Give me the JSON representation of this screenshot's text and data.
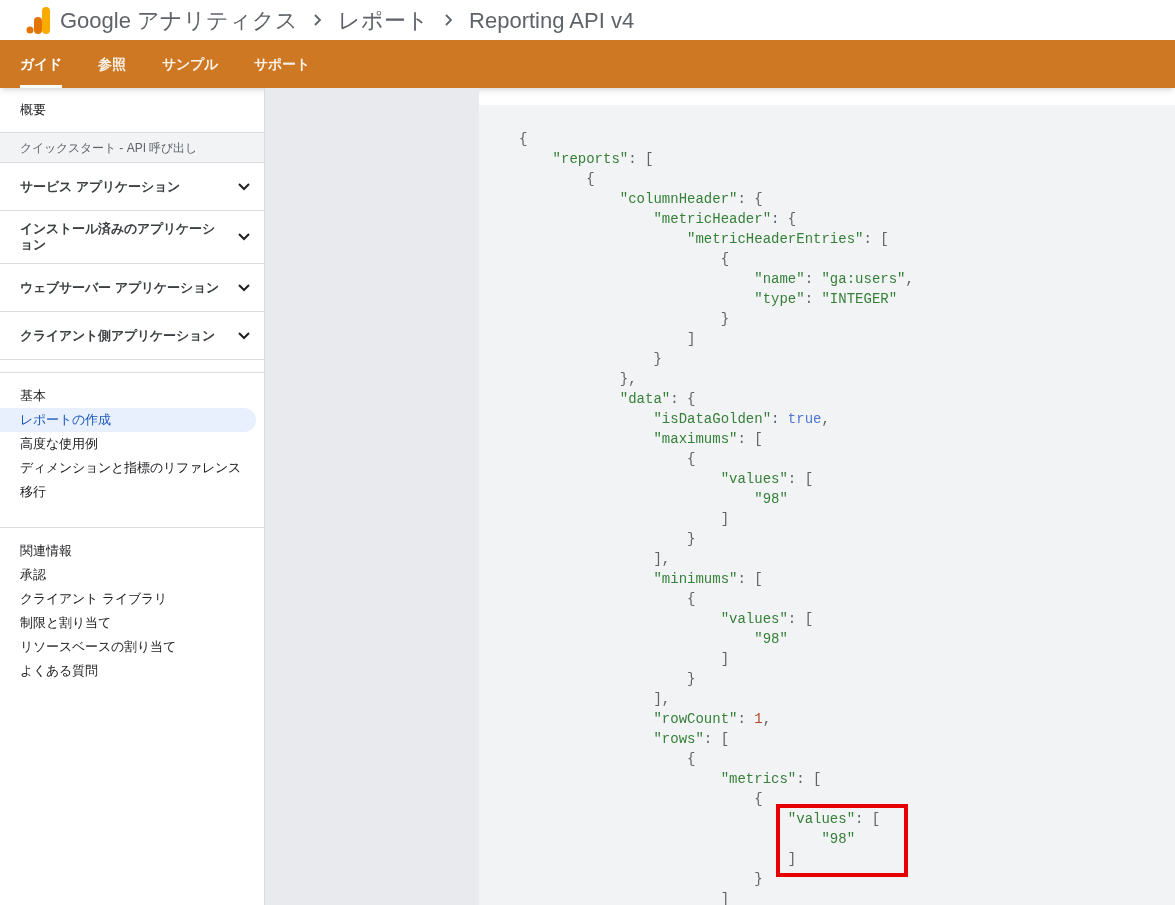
{
  "header": {
    "breadcrumbs": [
      "Google アナリティクス",
      "レポート",
      "Reporting API v4"
    ]
  },
  "tabs": [
    {
      "label": "ガイド",
      "selected": true
    },
    {
      "label": "参照",
      "selected": false
    },
    {
      "label": "サンプル",
      "selected": false
    },
    {
      "label": "サポート",
      "selected": false
    }
  ],
  "sidebar": {
    "top": [
      {
        "kind": "link",
        "label": "概要"
      },
      {
        "kind": "section_header",
        "label": "クイックスタート - API 呼び出し"
      },
      {
        "kind": "expandable",
        "label": "サービス アプリケーション",
        "expanded": false
      },
      {
        "kind": "expandable",
        "label": "インストール済みのアプリケーション",
        "expanded": false
      },
      {
        "kind": "expandable",
        "label": "ウェブサーバー アプリケーション",
        "expanded": false
      },
      {
        "kind": "expandable",
        "label": "クライアント側アプリケーション",
        "expanded": false
      }
    ],
    "groups": [
      [
        {
          "label": "基本",
          "selected": false
        },
        {
          "label": "レポートの作成",
          "selected": true
        },
        {
          "label": "高度な使用例",
          "selected": false
        },
        {
          "label": "ディメンションと指標のリファレンス",
          "selected": false
        },
        {
          "label": "移行",
          "selected": false
        }
      ],
      [
        {
          "label": "関連情報",
          "selected": false
        },
        {
          "label": "承認",
          "selected": false
        },
        {
          "label": "クライアント ライブラリ",
          "selected": false
        },
        {
          "label": "制限と割り当て",
          "selected": false
        },
        {
          "label": "リソースベースの割り当て",
          "selected": false
        },
        {
          "label": "よくある質問",
          "selected": false
        }
      ]
    ]
  },
  "code": {
    "lines": [
      [
        {
          "kind": "punct",
          "text": "{"
        }
      ],
      [
        {
          "kind": "string",
          "text": "    \"reports\""
        },
        {
          "kind": "punct",
          "text": ": ["
        }
      ],
      [
        {
          "kind": "punct",
          "text": "        {"
        }
      ],
      [
        {
          "kind": "string",
          "text": "            \"columnHeader\""
        },
        {
          "kind": "punct",
          "text": ": {"
        }
      ],
      [
        {
          "kind": "string",
          "text": "                \"metricHeader\""
        },
        {
          "kind": "punct",
          "text": ": {"
        }
      ],
      [
        {
          "kind": "string",
          "text": "                    \"metricHeaderEntries\""
        },
        {
          "kind": "punct",
          "text": ": ["
        }
      ],
      [
        {
          "kind": "punct",
          "text": "                        {"
        }
      ],
      [
        {
          "kind": "string",
          "text": "                            \"name\""
        },
        {
          "kind": "punct",
          "text": ": "
        },
        {
          "kind": "string",
          "text": "\"ga:users\""
        },
        {
          "kind": "punct",
          "text": ","
        }
      ],
      [
        {
          "kind": "string",
          "text": "                            \"type\""
        },
        {
          "kind": "punct",
          "text": ": "
        },
        {
          "kind": "string",
          "text": "\"INTEGER\""
        }
      ],
      [
        {
          "kind": "punct",
          "text": "                        }"
        }
      ],
      [
        {
          "kind": "punct",
          "text": "                    ]"
        }
      ],
      [
        {
          "kind": "punct",
          "text": "                }"
        }
      ],
      [
        {
          "kind": "punct",
          "text": "            },"
        }
      ],
      [
        {
          "kind": "string",
          "text": "            \"data\""
        },
        {
          "kind": "punct",
          "text": ": {"
        }
      ],
      [
        {
          "kind": "string",
          "text": "                \"isDataGolden\""
        },
        {
          "kind": "punct",
          "text": ": "
        },
        {
          "kind": "literal",
          "text": "true"
        },
        {
          "kind": "punct",
          "text": ","
        }
      ],
      [
        {
          "kind": "string",
          "text": "                \"maximums\""
        },
        {
          "kind": "punct",
          "text": ": ["
        }
      ],
      [
        {
          "kind": "punct",
          "text": "                    {"
        }
      ],
      [
        {
          "kind": "string",
          "text": "                        \"values\""
        },
        {
          "kind": "punct",
          "text": ": ["
        }
      ],
      [
        {
          "kind": "string",
          "text": "                            \"98\""
        }
      ],
      [
        {
          "kind": "punct",
          "text": "                        ]"
        }
      ],
      [
        {
          "kind": "punct",
          "text": "                    }"
        }
      ],
      [
        {
          "kind": "punct",
          "text": "                ],"
        }
      ],
      [
        {
          "kind": "string",
          "text": "                \"minimums\""
        },
        {
          "kind": "punct",
          "text": ": ["
        }
      ],
      [
        {
          "kind": "punct",
          "text": "                    {"
        }
      ],
      [
        {
          "kind": "string",
          "text": "                        \"values\""
        },
        {
          "kind": "punct",
          "text": ": ["
        }
      ],
      [
        {
          "kind": "string",
          "text": "                            \"98\""
        }
      ],
      [
        {
          "kind": "punct",
          "text": "                        ]"
        }
      ],
      [
        {
          "kind": "punct",
          "text": "                    }"
        }
      ],
      [
        {
          "kind": "punct",
          "text": "                ],"
        }
      ],
      [
        {
          "kind": "string",
          "text": "                \"rowCount\""
        },
        {
          "kind": "punct",
          "text": ": "
        },
        {
          "kind": "number",
          "text": "1"
        },
        {
          "kind": "punct",
          "text": ","
        }
      ],
      [
        {
          "kind": "string",
          "text": "                \"rows\""
        },
        {
          "kind": "punct",
          "text": ": ["
        }
      ],
      [
        {
          "kind": "punct",
          "text": "                    {"
        }
      ],
      [
        {
          "kind": "string",
          "text": "                        \"metrics\""
        },
        {
          "kind": "punct",
          "text": ": ["
        }
      ],
      [
        {
          "kind": "punct",
          "text": "                            {"
        }
      ],
      {
        "highlighted": true,
        "lines": [
          [
            {
              "kind": "string",
              "text": "                                \"values\""
            },
            {
              "kind": "punct",
              "text": ": ["
            }
          ],
          [
            {
              "kind": "string",
              "text": "                                    \"98\""
            }
          ],
          [
            {
              "kind": "punct",
              "text": "                                ]"
            }
          ]
        ]
      },
      [
        {
          "kind": "punct",
          "text": "                            }"
        }
      ],
      [
        {
          "kind": "punct",
          "text": "                        ]"
        }
      ]
    ]
  }
}
